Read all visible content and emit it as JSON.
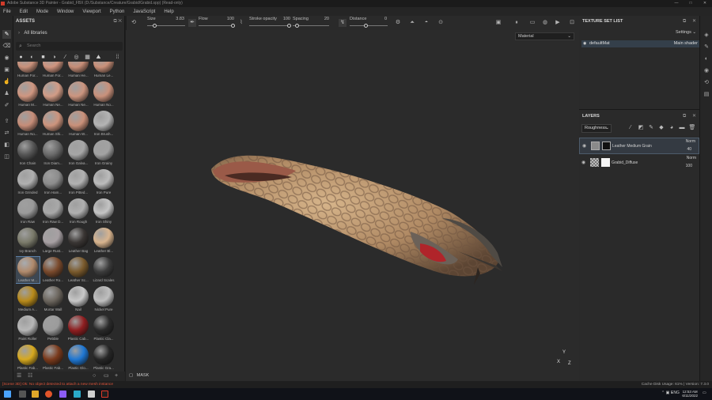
{
  "window": {
    "title": "Adobe Substance 3D Painter - Grabid_FBX (D:/Substance/Creature/Grabid/Grabid.spp) (Read-only)",
    "controls": [
      "—",
      "□",
      "✕"
    ]
  },
  "menu": [
    "File",
    "Edit",
    "Mode",
    "Window",
    "Viewport",
    "Python",
    "JavaScript",
    "Help"
  ],
  "toolbar": {
    "size_label": "Size",
    "size_value": "3.83",
    "flow_label": "Flow",
    "flow_value": "100",
    "stroke_opacity_label": "Stroke opacity",
    "stroke_opacity_value": "100",
    "spacing_label": "Spacing",
    "spacing_value": "20",
    "distance_label": "Distance",
    "distance_value": "0"
  },
  "assets": {
    "title": "ASSETS",
    "libraries_label": "All libraries",
    "search_placeholder": "Search",
    "items": [
      {
        "label": "Human For...",
        "color": "#c9917b"
      },
      {
        "label": "Human For...",
        "color": "#cf947f"
      },
      {
        "label": "Human He...",
        "color": "#c68d77"
      },
      {
        "label": "Human Le...",
        "color": "#c99079"
      },
      {
        "label": "Human M...",
        "color": "#cf9680"
      },
      {
        "label": "Human Ne...",
        "color": "#d29c86"
      },
      {
        "label": "Human Ne...",
        "color": "#cc957f"
      },
      {
        "label": "Human No...",
        "color": "#c9917b"
      },
      {
        "label": "Human No...",
        "color": "#c68d78"
      },
      {
        "label": "Human Shi...",
        "color": "#cd947d"
      },
      {
        "label": "Human W...",
        "color": "#c99079"
      },
      {
        "label": "Iron Brush...",
        "color": "#b4b4b4"
      },
      {
        "label": "Iron Chain",
        "color": "#555555"
      },
      {
        "label": "Iron Diam...",
        "color": "#6a6a6a"
      },
      {
        "label": "Iron Galva...",
        "color": "#a6a6a6"
      },
      {
        "label": "Iron Grainy",
        "color": "#a2a2a2"
      },
      {
        "label": "Iron Grinded",
        "color": "#b0b0b0"
      },
      {
        "label": "Iron Ham...",
        "color": "#8c8c8c"
      },
      {
        "label": "Iron Pitted...",
        "color": "#b2b2b2"
      },
      {
        "label": "Iron Pure",
        "color": "#bcbcbc"
      },
      {
        "label": "Iron Raw",
        "color": "#9a9a9a"
      },
      {
        "label": "Iron Raw D...",
        "color": "#a8a8a8"
      },
      {
        "label": "Iron Rough",
        "color": "#b0b0b0"
      },
      {
        "label": "Iron Shiny",
        "color": "#c4c4c4"
      },
      {
        "label": "Ivy Branch",
        "color": "#7a7a6a"
      },
      {
        "label": "Large Rust...",
        "color": "#a7a0a3"
      },
      {
        "label": "Leather Bag",
        "color": "#3a3634"
      },
      {
        "label": "Leather Bl...",
        "color": "#d8b48e"
      },
      {
        "label": "Leather M...",
        "color": "#b08a6c"
      },
      {
        "label": "Leather Ro...",
        "color": "#7a4a2c"
      },
      {
        "label": "Leather Sc...",
        "color": "#7a5a2c"
      },
      {
        "label": "Lizard Scales",
        "color": "#3c3c3c"
      },
      {
        "label": "Medium A...",
        "color": "#b88a1a"
      },
      {
        "label": "Mortar Wall",
        "color": "#6c665e"
      },
      {
        "label": "Nail",
        "color": "#c8c8c8"
      },
      {
        "label": "Nickel Pure",
        "color": "#bfbfbf"
      },
      {
        "label": "Paint Roller",
        "color": "#b7b7b7"
      },
      {
        "label": "Pebble",
        "color": "#9c9c9c"
      },
      {
        "label": "Plastic Cab...",
        "color": "#8f1e20"
      },
      {
        "label": "Plastic Cla...",
        "color": "#2a2a2a"
      },
      {
        "label": "Plastic Fab...",
        "color": "#d7a91f"
      },
      {
        "label": "Plastic Fab...",
        "color": "#7a3a1c"
      },
      {
        "label": "Plastic Glo...",
        "color": "#1f77d3"
      },
      {
        "label": "Plastic Gra...",
        "color": "#262626"
      }
    ],
    "selected_index": 28
  },
  "viewport": {
    "material_mode": "Material",
    "mask_label": "MASK"
  },
  "texture_set_list": {
    "title": "TEXTURE SET LIST",
    "settings_label": "Settings",
    "set_name": "defaultMat",
    "shader_name": "Main shader"
  },
  "layers": {
    "title": "LAYERS",
    "channel": "Roughness",
    "items": [
      {
        "name": "Leather Medium Grain",
        "blend": "Norm",
        "opacity": "40",
        "selected": true
      },
      {
        "name": "Grabid_Diffuse",
        "blend": "Norm",
        "opacity": "100",
        "selected": false
      }
    ]
  },
  "statusbar": {
    "error": "[Scene 3D] Ok: No object detected to attach a new mesh instance",
    "info": "Cache Disk Usage: 61% | Version: 7.3.0"
  },
  "taskbar": {
    "time": "12:53 AM",
    "date": "6/11/2022",
    "lang": "ENG"
  }
}
